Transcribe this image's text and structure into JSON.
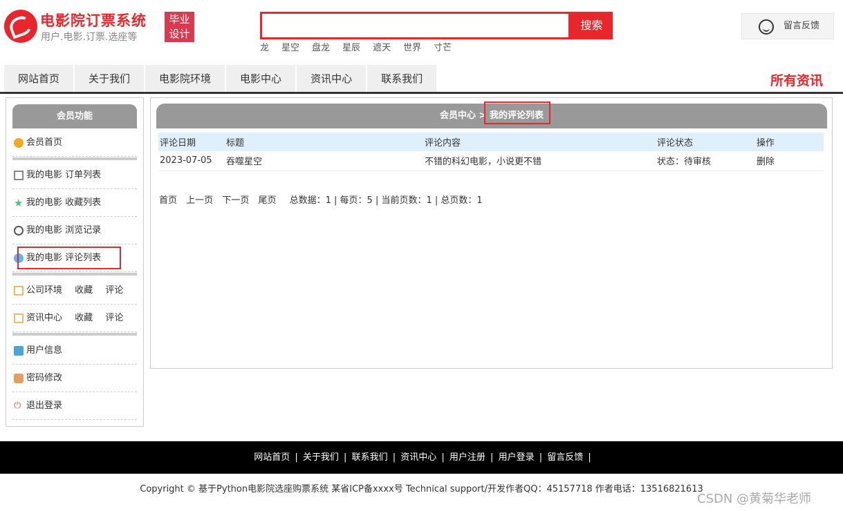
{
  "header": {
    "title": "电影院订票系统",
    "subtitle": "用户.电影.订票.选座等",
    "badge_line1": "毕业",
    "badge_line2": "设计",
    "search_placeholder": "",
    "search_button": "搜索",
    "hot_words": [
      "龙",
      "星空",
      "盘龙",
      "星辰",
      "遮天",
      "世界",
      "寸芒"
    ],
    "feedback": "留言反馈"
  },
  "nav": {
    "items": [
      "网站首页",
      "关于我们",
      "电影院环境",
      "电影中心",
      "资讯中心",
      "联系我们"
    ],
    "right": "所有资讯"
  },
  "sidebar": {
    "title": "会员功能",
    "member_home": "会员首页",
    "orders": "我的电影 订单列表",
    "favorites": "我的电影 收藏列表",
    "history": "我的电影 浏览记录",
    "comments": "我的电影 评论列表",
    "env": {
      "label": "公司环境",
      "fav": "收藏",
      "comment": "评论"
    },
    "news": {
      "label": "资讯中心",
      "fav": "收藏",
      "comment": "评论"
    },
    "user_info": "用户信息",
    "password": "密码修改",
    "logout": "退出登录"
  },
  "main": {
    "crumb_parent": "会员中心",
    "crumb_sep": " > ",
    "crumb_current": "我的评论列表",
    "columns": [
      "评论日期",
      "标题",
      "评论内容",
      "评论状态",
      "操作"
    ],
    "rows": [
      {
        "date": "2023-07-05",
        "title": "吞噬星空",
        "content": "不错的科幻电影，小说更不错",
        "status": "状态：待审核",
        "action": "删除"
      }
    ],
    "pager": {
      "first": "首页",
      "prev": "上一页",
      "next": "下一页",
      "last": "尾页",
      "summary": "总数据：1 | 每页：5 | 当前页数：1 | 总页数：1"
    }
  },
  "footer": {
    "links": [
      "网站首页",
      "关于我们",
      "联系我们",
      "资讯中心",
      "用户注册",
      "用户登录",
      "留言反馈"
    ],
    "copyright": "Copyright © 基于Python电影院选座购票系统 某省ICP备xxxx号    Technical support/开发作者QQ：45157718    作者电话：13516821613",
    "watermark": "CSDN @黄菊华老师"
  },
  "colors": {
    "accent": "#e8262c",
    "header_gray": "#999999",
    "table_head": "#dfeffb"
  }
}
